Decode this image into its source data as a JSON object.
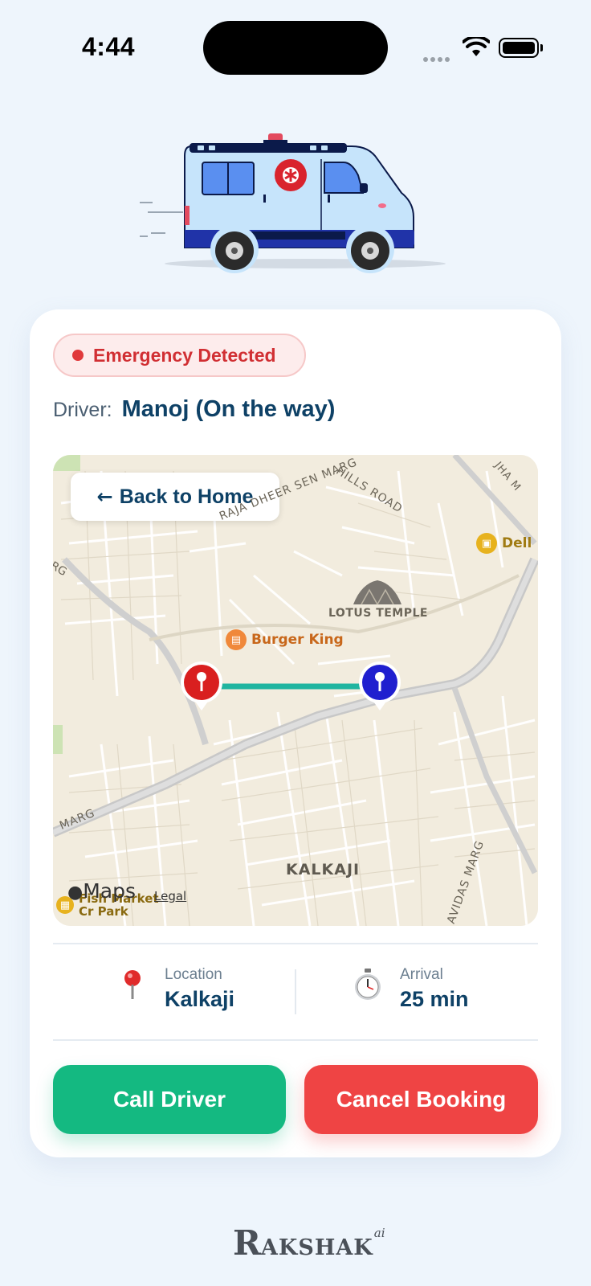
{
  "status_bar": {
    "time": "4:44"
  },
  "card": {
    "badge": "Emergency Detected",
    "driver_label": "Driver:",
    "driver_name": "Manoj (On the way)"
  },
  "map": {
    "back_button": "Back to Home",
    "labels": {
      "raja_dheer": "RAJA DHEER SEN MARG",
      "hills_road": "HILLS ROAD",
      "jha": "JHA M",
      "rg": "RG",
      "lotus": "LOTUS TEMPLE",
      "burger": "Burger King",
      "dell": "Dell",
      "marg_left": "MARG",
      "kalkaji": "KALKAJI",
      "avidas": "AVIDAS MARG",
      "fish": "Fish Market",
      "crpark": "Cr Park"
    },
    "maps_brand": "Maps",
    "legal": "Legal"
  },
  "info": {
    "location_label": "Location",
    "location_value": "Kalkaji",
    "arrival_label": "Arrival",
    "arrival_value": "25 min"
  },
  "actions": {
    "call": "Call Driver",
    "cancel": "Cancel Booking"
  },
  "brand": {
    "first": "R",
    "rest": "AKSHAK",
    "suffix": "ai"
  },
  "colors": {
    "accent_green": "#14b981",
    "accent_red": "#ef4444",
    "badge_red": "#d12f33",
    "navy": "#0e4166",
    "route": "#20b5a0",
    "pin_start": "#d91f1f",
    "pin_end": "#1f1fcf"
  }
}
